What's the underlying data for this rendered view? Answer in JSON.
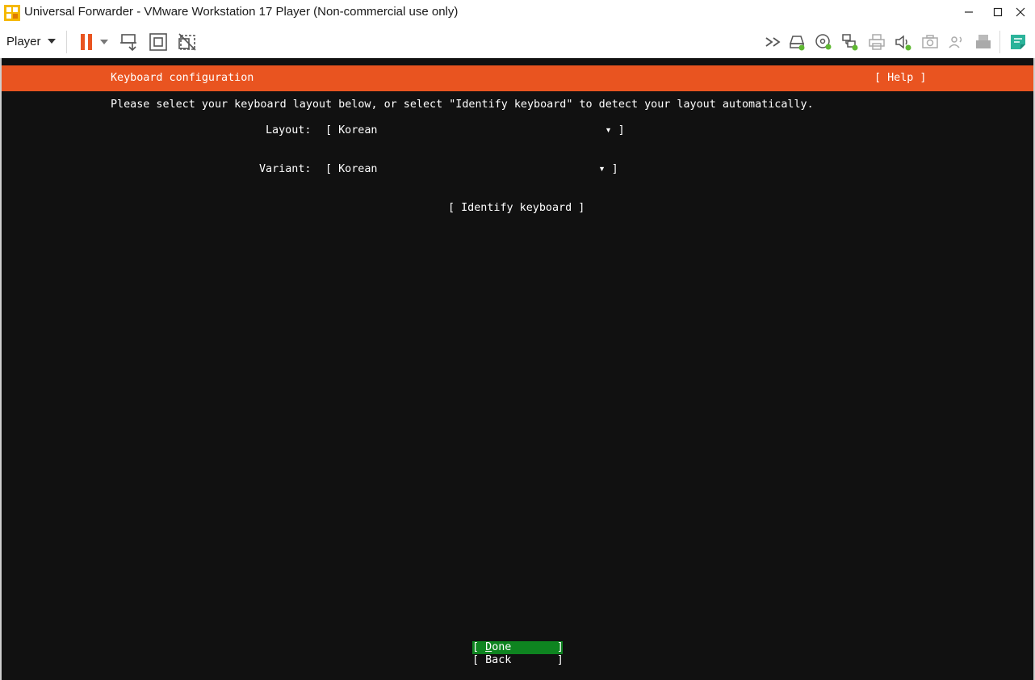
{
  "window": {
    "title": "Universal Forwarder - VMware Workstation 17 Player (Non-commercial use only)"
  },
  "toolbar": {
    "player_label": "Player"
  },
  "installer": {
    "header_title": "Keyboard configuration",
    "help_label": "[ Help ]",
    "instructions": "Please select your keyboard layout below, or select \"Identify keyboard\" to detect your layout automatically.",
    "layout": {
      "label": "Layout:",
      "open_bracket": "[ ",
      "value": "Korean",
      "arrow": "▾",
      "close_bracket": " ]"
    },
    "variant": {
      "label": "Variant:",
      "open_bracket": "[ ",
      "value": "Korean",
      "arrow": "▾",
      "close_bracket": " ]"
    },
    "identify_label": "[ Identify keyboard ]",
    "done": {
      "open": "[ ",
      "first_char": "D",
      "rest": "one",
      "close": "       ]"
    },
    "back": {
      "open": "[ ",
      "label": "Back",
      "close": "       ]"
    }
  },
  "colors": {
    "header_orange": "#e95420",
    "done_green": "#0e8420",
    "screen_bg": "#111111"
  }
}
